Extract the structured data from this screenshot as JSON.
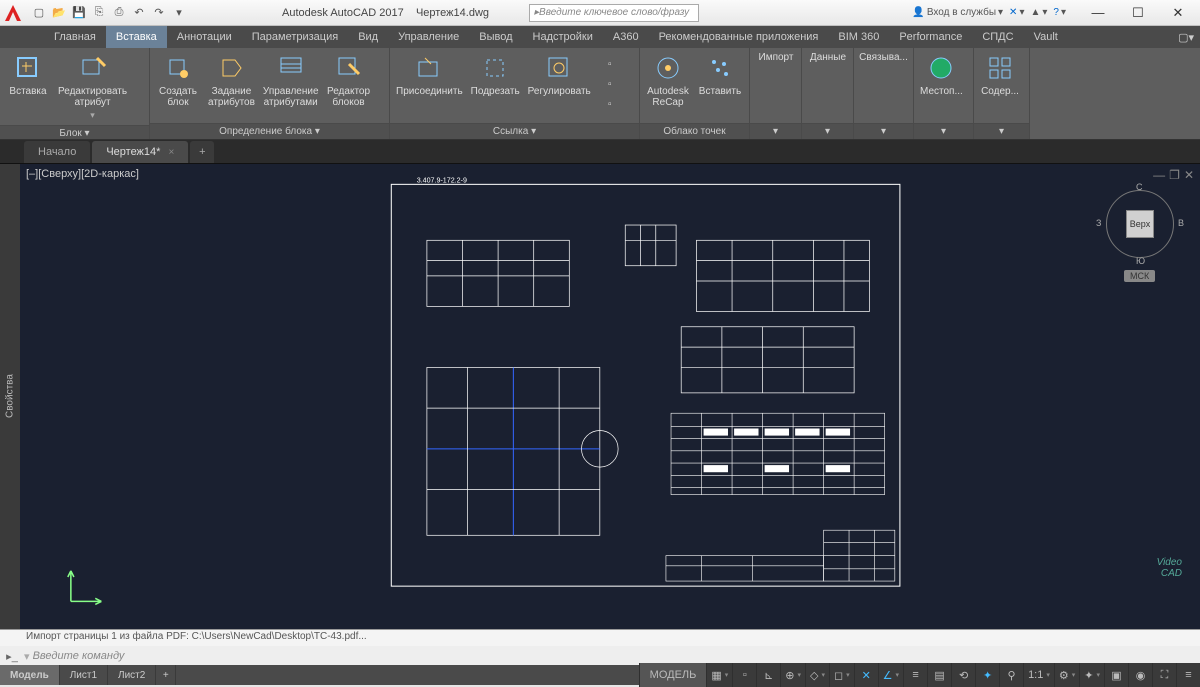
{
  "titlebar": {
    "app_name": "Autodesk AutoCAD 2017",
    "file_name": "Чертеж14.dwg",
    "search_placeholder": "Введите ключевое слово/фразу",
    "login_label": "Вход в службы"
  },
  "menubar": {
    "tabs": [
      "Главная",
      "Вставка",
      "Аннотации",
      "Параметризация",
      "Вид",
      "Управление",
      "Вывод",
      "Надстройки",
      "A360",
      "Рекомендованные приложения",
      "BIM 360",
      "Performance",
      "СПДС",
      "Vault"
    ],
    "active_index": 1
  },
  "ribbon": {
    "panels": [
      {
        "title": "Блок ▾",
        "buttons": [
          {
            "label": "Вставка"
          },
          {
            "label": "Редактировать\nатрибут"
          }
        ]
      },
      {
        "title": "Определение блока ▾",
        "buttons": [
          {
            "label": "Создать\nблок"
          },
          {
            "label": "Задание\nатрибутов"
          },
          {
            "label": "Управление\nатрибутами"
          },
          {
            "label": "Редактор\nблоков"
          }
        ]
      },
      {
        "title": "Ссылка ▾",
        "buttons": [
          {
            "label": "Присоединить"
          },
          {
            "label": "Подрезать"
          },
          {
            "label": "Регулировать"
          }
        ]
      },
      {
        "title": "Облако точек",
        "buttons": [
          {
            "label": "Autodesk\nReCap"
          },
          {
            "label": "Вставить"
          }
        ]
      },
      {
        "title": "",
        "buttons": [
          {
            "label": "Импорт"
          }
        ]
      },
      {
        "title": "",
        "buttons": [
          {
            "label": "Данные"
          }
        ]
      },
      {
        "title": "",
        "buttons": [
          {
            "label": "Связыва..."
          }
        ]
      },
      {
        "title": "",
        "buttons": [
          {
            "label": "Местоп..."
          }
        ]
      },
      {
        "title": "",
        "buttons": [
          {
            "label": "Содер..."
          }
        ]
      }
    ]
  },
  "filetabs": {
    "tabs": [
      {
        "label": "Начало"
      },
      {
        "label": "Чертеж14*"
      }
    ],
    "active_index": 1
  },
  "sidebar_tab": "Свойства",
  "viewport": {
    "label": "[–][Сверху][2D-каркас]",
    "drawing_num": "3.407.9-172.2-9"
  },
  "viewcube": {
    "face": "Верх",
    "dirs": {
      "n": "С",
      "s": "Ю",
      "e": "В",
      "w": "З"
    },
    "wcs": "МСК"
  },
  "command": {
    "history": "Импорт страницы 1 из файла PDF: C:\\Users\\NewCad\\Desktop\\ТС-43.pdf...",
    "prompt": "Введите команду"
  },
  "layouttabs": {
    "tabs": [
      "Модель",
      "Лист1",
      "Лист2"
    ],
    "active_index": 0
  },
  "status": {
    "model": "МОДЕЛЬ",
    "scale": "1:1"
  },
  "watermark": "Video\nCAD"
}
